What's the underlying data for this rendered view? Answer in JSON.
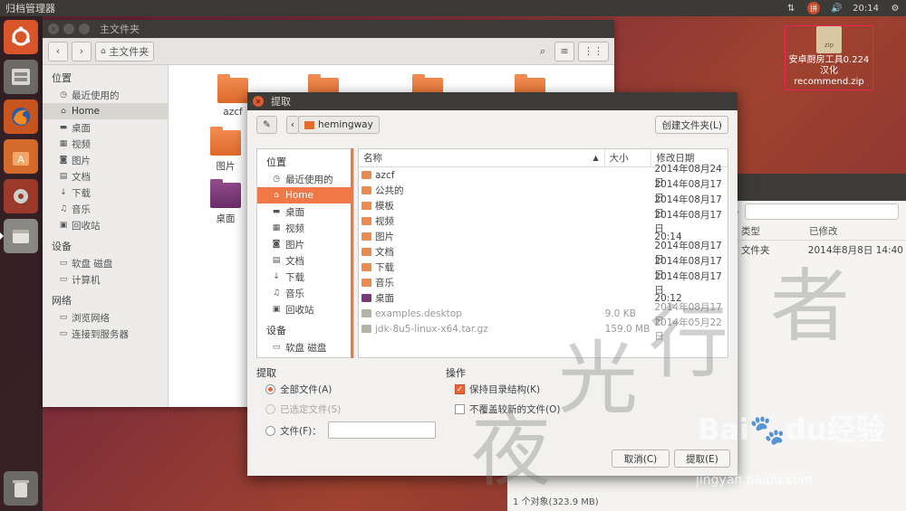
{
  "panel": {
    "app_title": "归档管理器",
    "time": "20:14"
  },
  "desktop": {
    "zip_label": "zip",
    "zip_name": "安卓厨房工具0.224汉化 recommend.zip"
  },
  "file_manager": {
    "window_title": "主文件夹",
    "path_label": "主文件夹",
    "sidebar": {
      "places_title": "位置",
      "places": [
        "最近使用的",
        "Home",
        "桌面",
        "视频",
        "图片",
        "文档",
        "下载",
        "音乐",
        "回收站"
      ],
      "devices_title": "设备",
      "devices": [
        "软盘 磁盘",
        "计算机"
      ],
      "network_title": "网络",
      "network": [
        "浏览网络",
        "连接到服务器"
      ]
    },
    "folders": [
      "azcf",
      "图片",
      "桌面"
    ]
  },
  "bg_window": {
    "col_type": "类型",
    "col_modified": "已修改",
    "row_type": "文件夹",
    "row_modified": "2014年8月8日 14:40",
    "status": "1 个对象(323.9 MB)"
  },
  "dialog": {
    "title": "提取",
    "path_button": "hemingway",
    "new_folder_button": "创建文件夹(L)",
    "places_title": "位置",
    "places": [
      "最近使用的",
      "Home",
      "桌面",
      "视频",
      "图片",
      "文档",
      "下载",
      "音乐",
      "回收站"
    ],
    "devices_title": "设备",
    "devices": [
      "软盘 磁盘"
    ],
    "columns": {
      "name": "名称",
      "size": "大小",
      "date": "修改日期"
    },
    "files": [
      {
        "name": "azcf",
        "size": "",
        "date": "2014年08月24日",
        "icon": "folder"
      },
      {
        "name": "公共的",
        "size": "",
        "date": "2014年08月17日",
        "icon": "folder"
      },
      {
        "name": "模板",
        "size": "",
        "date": "2014年08月17日",
        "icon": "folder"
      },
      {
        "name": "视频",
        "size": "",
        "date": "2014年08月17日",
        "icon": "folder"
      },
      {
        "name": "图片",
        "size": "",
        "date": "20:14",
        "icon": "folder"
      },
      {
        "name": "文档",
        "size": "",
        "date": "2014年08月17日",
        "icon": "folder"
      },
      {
        "name": "下载",
        "size": "",
        "date": "2014年08月17日",
        "icon": "folder"
      },
      {
        "name": "音乐",
        "size": "",
        "date": "2014年08月17日",
        "icon": "folder"
      },
      {
        "name": "桌面",
        "size": "",
        "date": "20:12",
        "icon": "folder-purple"
      },
      {
        "name": "examples.desktop",
        "size": "9.0 KB",
        "date": "2014年08月17日",
        "icon": "file"
      },
      {
        "name": "jdk-8u5-linux-x64.tar.gz",
        "size": "159.0 MB",
        "date": "2014年05月22日",
        "icon": "file"
      }
    ],
    "extract_title": "提取",
    "opt_all": "全部文件(A)",
    "opt_selected": "已选定文件(S)",
    "opt_files": "文件(F)：",
    "action_title": "操作",
    "opt_keep_structure": "保持目录结构(K)",
    "opt_no_overwrite": "不覆盖较新的文件(O)",
    "cancel_button": "取消(C)",
    "extract_button": "提取(E)"
  },
  "watermark": {
    "chars": [
      "夜",
      "光",
      "行",
      "者"
    ],
    "logo_text": "Bai",
    "logo_tail": "du经验",
    "url": "jingyan.baidu.com"
  }
}
